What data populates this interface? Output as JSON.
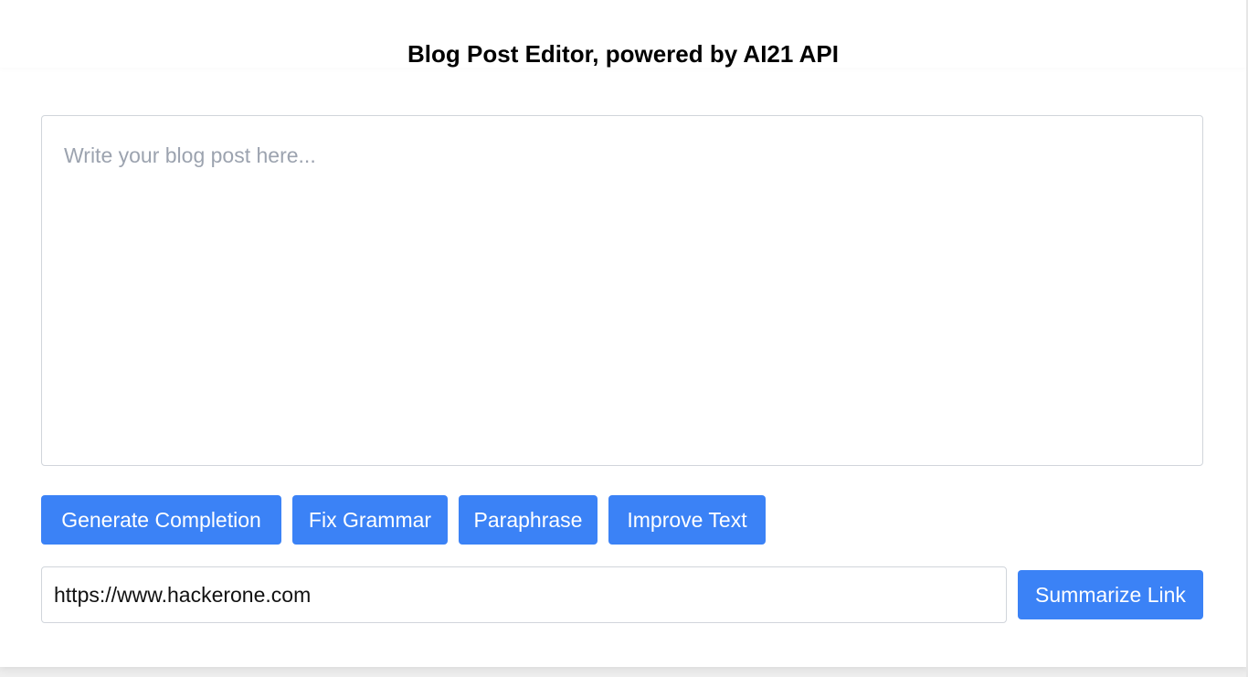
{
  "header": {
    "title": "Blog Post Editor, powered by AI21 API"
  },
  "editor": {
    "value": "",
    "placeholder": "Write your blog post here..."
  },
  "actions": {
    "generate_label": "Generate Completion",
    "grammar_label": "Fix Grammar",
    "paraphrase_label": "Paraphrase",
    "improve_label": "Improve Text"
  },
  "link": {
    "value": "https://www.hackerone.com",
    "summarize_label": "Summarize Link"
  },
  "colors": {
    "accent": "#3b82f6",
    "border": "#d1d5db",
    "placeholder": "#9ca3af"
  }
}
